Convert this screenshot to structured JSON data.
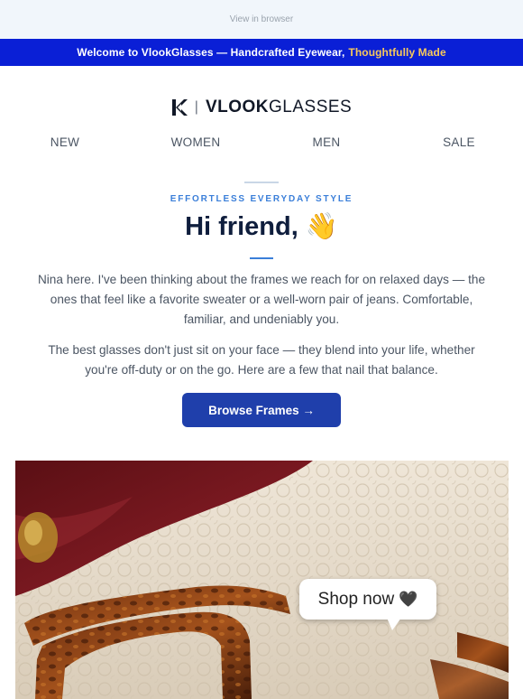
{
  "header": {
    "view_in_browser": "View in browser"
  },
  "promo": {
    "text": "Welcome to VlookGlasses — Handcrafted Eyewear,",
    "highlight": "Thoughtfully Made",
    "highlight_color": "#f8c95b",
    "background": "#0a1fd6"
  },
  "logo": {
    "brand_bold": "VLOOK",
    "brand_light": "GLASSES",
    "separator": "|",
    "icon": "k-logo-icon"
  },
  "nav": {
    "items": [
      "NEW",
      "WOMEN",
      "MEN",
      "SALE"
    ]
  },
  "content": {
    "eyebrow": "EFFORTLESS EVERYDAY STYLE",
    "headline": "Hi friend, 👋",
    "paragraph_1": "Nina here. I've been thinking about the frames we reach for on relaxed days — the ones that feel like a favorite sweater or a well-worn pair of jeans. Comfortable, familiar, and undeniably you.",
    "paragraph_2": "The best glasses don't just sit on your face — they blend into your life, whether you're off-duty or on the go. Here are a few that nail that balance.",
    "cta_label": "Browse Frames →",
    "cta_color": "#1f3fab",
    "accent_color": "#3b7fd9"
  },
  "hero": {
    "bubble_text": "Shop now",
    "bubble_icon": "🖤"
  }
}
